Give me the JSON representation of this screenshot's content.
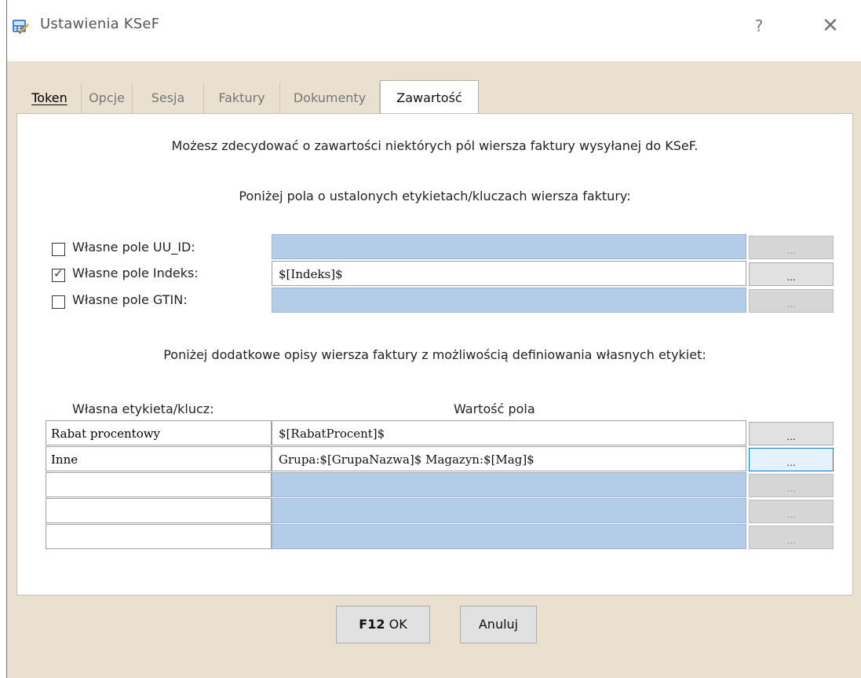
{
  "window": {
    "title": "Ustawienia KSeF",
    "help_label": "?",
    "close_label": "✕"
  },
  "tabs": [
    {
      "label": "Token",
      "active": false
    },
    {
      "label": "Opcje",
      "active": false
    },
    {
      "label": "Sesja",
      "active": false
    },
    {
      "label": "Faktury",
      "active": false
    },
    {
      "label": "Dokumenty",
      "active": false
    },
    {
      "label": "Zawartość",
      "active": true
    }
  ],
  "intro_text": "Możesz zdecydować o zawartości niektórych pól wiersza faktury wysyłanej do KSeF.",
  "fixed_fields_heading": "Poniżej pola o ustalonych etykietach/kluczach wiersza faktury:",
  "fixed_fields": [
    {
      "label": "Własne pole UU_ID:",
      "checked": false,
      "value": "",
      "button": "..."
    },
    {
      "label": "Własne pole Indeks:",
      "checked": true,
      "value": "$[Indeks]$",
      "button": "..."
    },
    {
      "label": "Własne pole GTIN:",
      "checked": false,
      "value": "",
      "button": "..."
    }
  ],
  "extra_heading": "Poniżej dodatkowe opisy wiersza faktury z możliwością definiowania własnych etykiet:",
  "columns": {
    "key": "Własna etykieta/klucz:",
    "value": "Wartość pola"
  },
  "rows": [
    {
      "key": "Rabat procentowy",
      "value": "$[RabatProcent]$",
      "button": "..."
    },
    {
      "key": "Inne",
      "value": "Grupa:$[GrupaNazwa]$ Magazyn:$[Mag]$",
      "button": "..."
    },
    {
      "key": "",
      "value": "",
      "button": "..."
    },
    {
      "key": "",
      "value": "",
      "button": "..."
    },
    {
      "key": "",
      "value": "",
      "button": "..."
    }
  ],
  "buttons": {
    "ok_key": "F12",
    "ok_label": "OK",
    "cancel_label": "Anuluj"
  },
  "colors": {
    "disabled_field": "#b3cde8",
    "window_bg": "#e9e0cf"
  }
}
